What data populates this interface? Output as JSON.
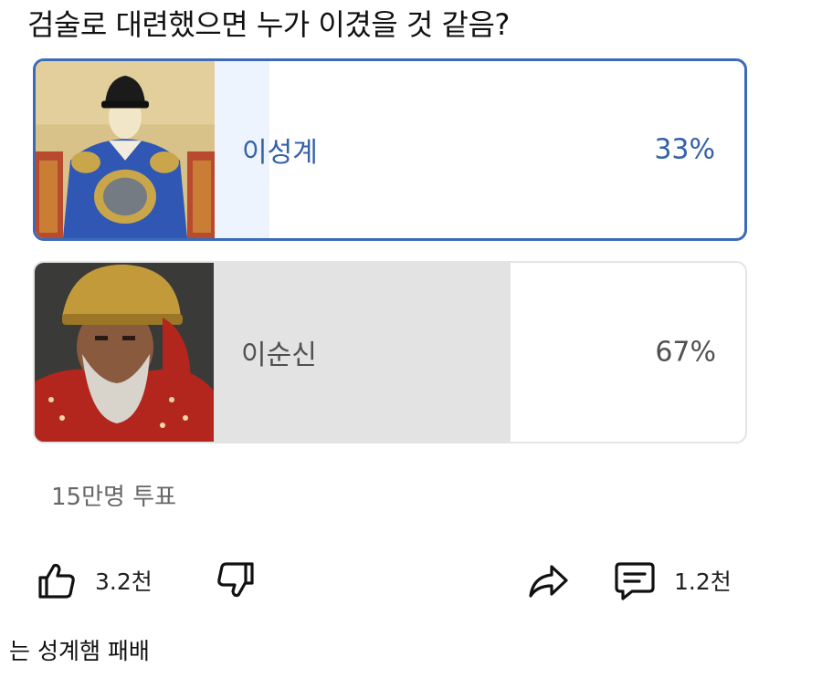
{
  "poll": {
    "question": "검술로 대련했으면 누가 이겼을 것 같음?",
    "options": [
      {
        "label": "이성계",
        "percent_text": "33%",
        "percent": 33,
        "selected": true
      },
      {
        "label": "이순신",
        "percent_text": "67%",
        "percent": 67,
        "selected": false
      }
    ],
    "vote_count": "15만명 투표"
  },
  "actions": {
    "like_count": "3.2천",
    "comment_count": "1.2천"
  },
  "caption": "는 성계햄 패배",
  "colors": {
    "accent": "#3b6bb8",
    "selected_fill": "#edf4fd",
    "unselected_fill": "#e3e3e3"
  },
  "icons": [
    "thumbs-up-icon",
    "thumbs-down-icon",
    "share-icon",
    "comment-icon"
  ]
}
